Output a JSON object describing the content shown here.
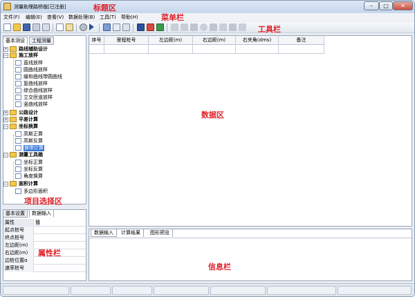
{
  "window": {
    "title": "测量助理路桥版[已注册]"
  },
  "annotations": {
    "title_area": "标题区",
    "menu_bar": "菜单栏",
    "toolbar": "工具栏",
    "data_area": "数据区",
    "project_area": "项目选择区",
    "property_bar": "属性栏",
    "info_bar": "信息栏"
  },
  "menu": [
    "文件(F)",
    "编辑(E)",
    "查看(V)",
    "数据处理(B)",
    "工具(T)",
    "帮助(H)"
  ],
  "left_tabs": [
    "基本测设",
    "工程测量"
  ],
  "tree": {
    "route_design": "路线辅助设计",
    "construction": "施工放样",
    "c_items": [
      "直线放样",
      "圆曲线放样",
      "缓和曲线带圆曲线",
      "复曲线放样",
      "综合曲线放样",
      "立交匝道放样",
      "竖曲线放样"
    ],
    "road_design": "公路设计",
    "leveling": "平差计算",
    "coord": "坐标换算",
    "coord_items": [
      "高斯正算",
      "高斯反算",
      "换带计算"
    ],
    "tools": "测量工具箱",
    "tool_items": [
      "坐标正算",
      "坐标反算",
      "角度换算"
    ],
    "area": "面积计算",
    "area_items": [
      "多边形面积"
    ]
  },
  "prop_tabs": [
    "基本设置",
    "数据输入"
  ],
  "props": {
    "header_name": "属性",
    "header_val": "值",
    "rows": [
      "起点桩号",
      "终点桩号",
      "左边距(m)",
      "右边距(m)",
      "边桩位置α",
      "速率桩号"
    ]
  },
  "grid_columns": [
    "序号",
    "里程桩号",
    "左边距(m)",
    "右边距(m)",
    "右夹角(dms)",
    "备注"
  ],
  "bottom_tabs": [
    "数据输入",
    "计算结果",
    "图形预览"
  ],
  "colors": {
    "annotation": "#e0202a",
    "selection": "#3d7bd6",
    "folder": "#f3c84b"
  }
}
